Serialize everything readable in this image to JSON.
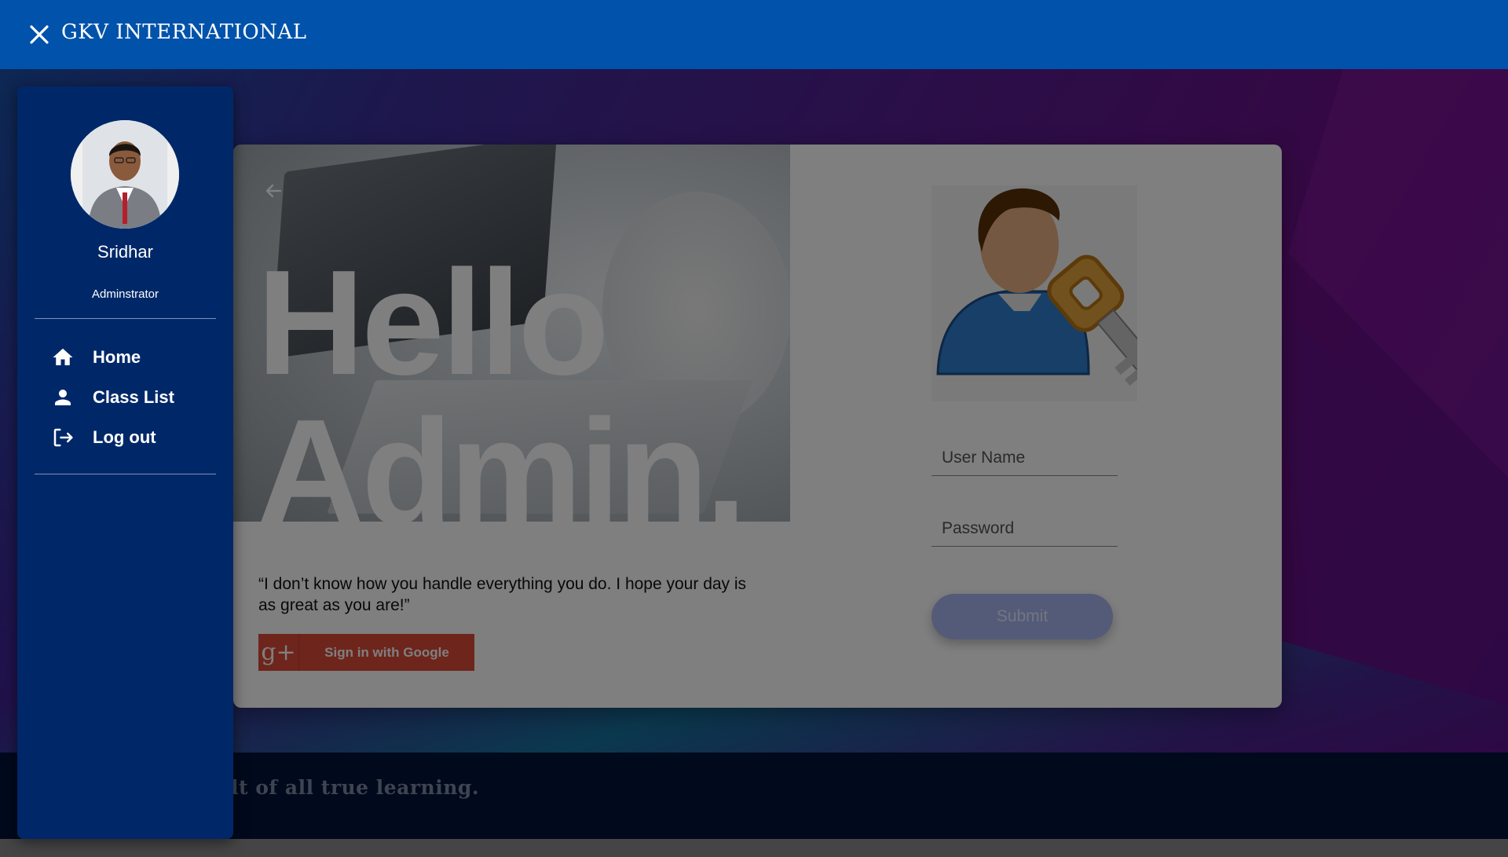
{
  "header": {
    "brand": "GKV INTERNATIONAL"
  },
  "sidebar": {
    "profile_name": "Sridhar",
    "profile_role": "Adminstrator",
    "items": [
      {
        "label": "Home",
        "icon": "home-icon"
      },
      {
        "label": "Class List",
        "icon": "person-icon"
      },
      {
        "label": "Log out",
        "icon": "logout-icon"
      }
    ]
  },
  "card": {
    "greeting_line1": "Hello",
    "greeting_line2": "Admin.",
    "quote": "“I don’t know how you handle everything you do. I hope your day is as great as you are!”",
    "google_button": "Sign in with Google",
    "google_icon_text": "g+",
    "username_placeholder": "User Name",
    "password_placeholder": "Password",
    "submit_label": "Submit"
  },
  "footer": {
    "quote_fragment": "lt of all true learning."
  },
  "colors": {
    "header_bg": "#0052aa",
    "sidebar_bg": "#002868",
    "google_red": "#dd4b39",
    "submit_bg": "#a9b6f2",
    "footer_bg": "#02133a"
  }
}
